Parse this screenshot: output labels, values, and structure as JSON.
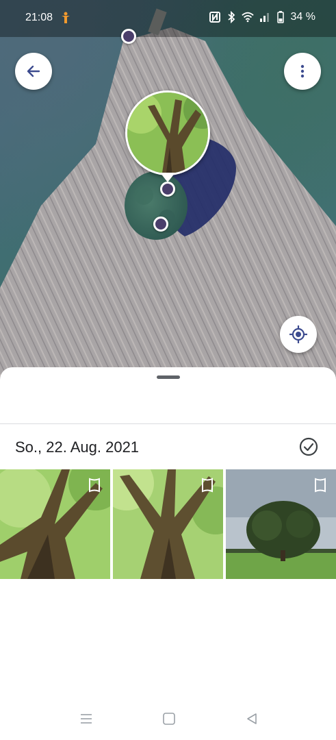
{
  "status_bar": {
    "time": "21:08",
    "battery": "34 %",
    "icons": [
      "accessibility-icon",
      "nfc-icon",
      "bluetooth-icon",
      "wifi-icon",
      "signal-icon",
      "battery-icon"
    ]
  },
  "map": {
    "buttons": {
      "back": "back-arrow-icon",
      "more": "more-vert-icon",
      "location": "my-location-icon"
    }
  },
  "sheet": {
    "date": "So., 22. Aug. 2021",
    "select_icon": "check-circle-icon",
    "photos": [
      {
        "type": "panorama",
        "icon": "panorama-icon"
      },
      {
        "type": "panorama",
        "icon": "panorama-icon"
      },
      {
        "type": "panorama",
        "icon": "panorama-icon"
      }
    ]
  },
  "nav_bar": {
    "buttons": [
      "menu-icon",
      "home-icon",
      "back-icon"
    ]
  },
  "colors": {
    "accent": "#3c4b8f",
    "pin": "#4a3e6b",
    "text": "#202124"
  }
}
